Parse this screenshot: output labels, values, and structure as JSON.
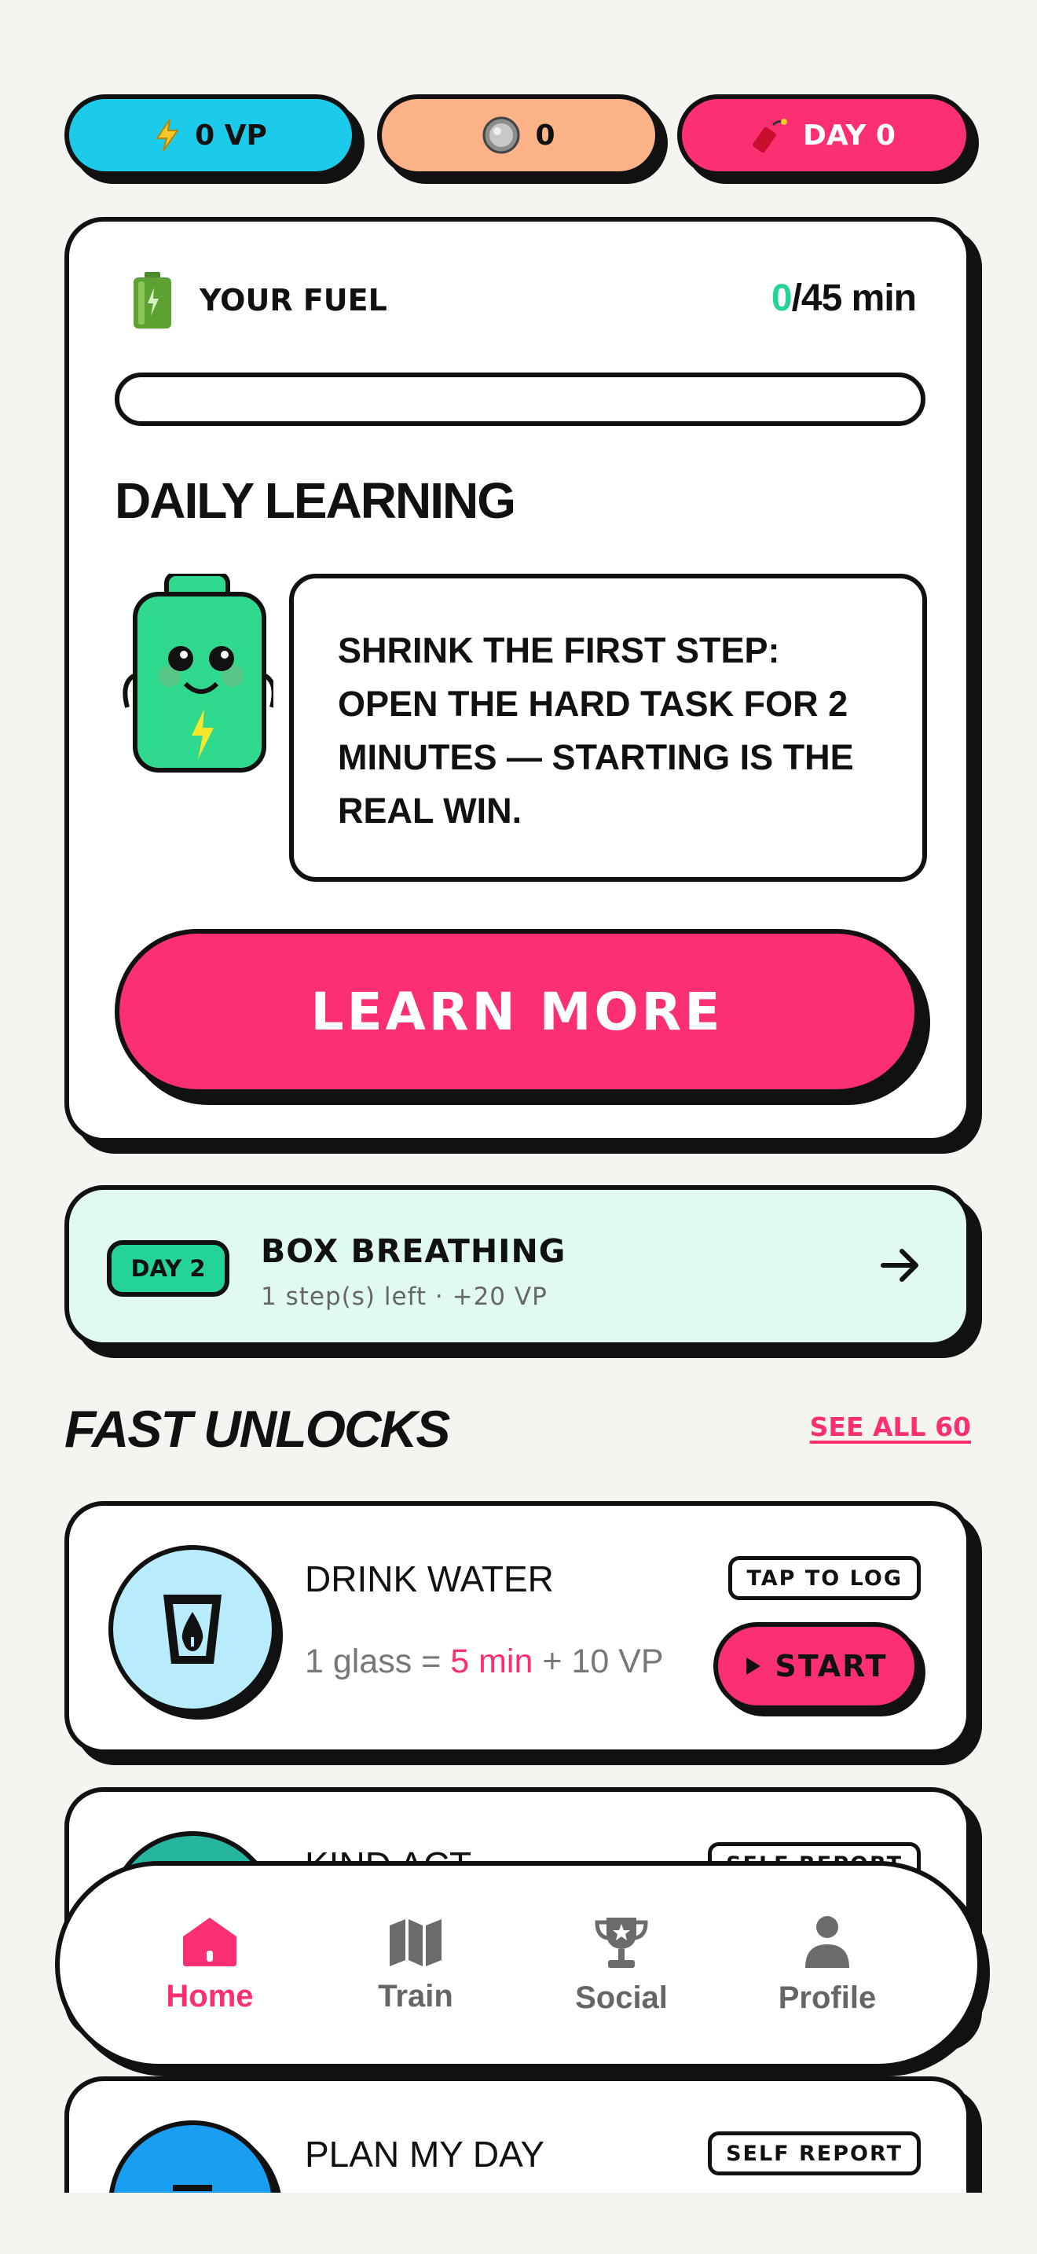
{
  "top_bar": {
    "vp": "0 VP",
    "coins": "0",
    "day": "DAY 0"
  },
  "fuel": {
    "label": "YOUR FUEL",
    "current": "0",
    "total": "/45 min",
    "progress_fraction": 0
  },
  "daily_learning": {
    "title": "DAILY LEARNING",
    "tip": "SHRINK THE FIRST STEP: OPEN THE HARD TASK FOR 2 MINUTES — STARTING IS THE REAL WIN.",
    "button": "LEARN MORE"
  },
  "routine": {
    "badge": "DAY 2",
    "title": "BOX BREATHING",
    "subtitle": "1 step(s) left · +20 VP"
  },
  "fast_unlocks": {
    "title": "FAST UNLOCKS",
    "see_all": "SEE ALL 60",
    "items": [
      {
        "title": "DRINK WATER",
        "tag": "TAP TO LOG",
        "sub_prefix": "1 glass = ",
        "sub_highlight": "5 min",
        "sub_suffix": " + 10 VP",
        "button": "START",
        "icon": "water-glass-icon"
      },
      {
        "title": "KIND ACT",
        "tag": "SELF REPORT",
        "icon": "kind-act-icon"
      },
      {
        "title": "PLAN MY DAY",
        "tag": "SELF REPORT",
        "icon": "plan-icon"
      }
    ]
  },
  "nav": {
    "items": [
      {
        "label": "Home",
        "icon": "home-icon"
      },
      {
        "label": "Train",
        "icon": "map-icon"
      },
      {
        "label": "Social",
        "icon": "trophy-icon"
      },
      {
        "label": "Profile",
        "icon": "person-icon"
      }
    ]
  },
  "colors": {
    "accent_pink": "#fb2f72",
    "accent_green": "#24d39a",
    "vp_cyan": "#1ccbe9",
    "coin_peach": "#fbb286",
    "breath_bg": "#e0faf2"
  }
}
